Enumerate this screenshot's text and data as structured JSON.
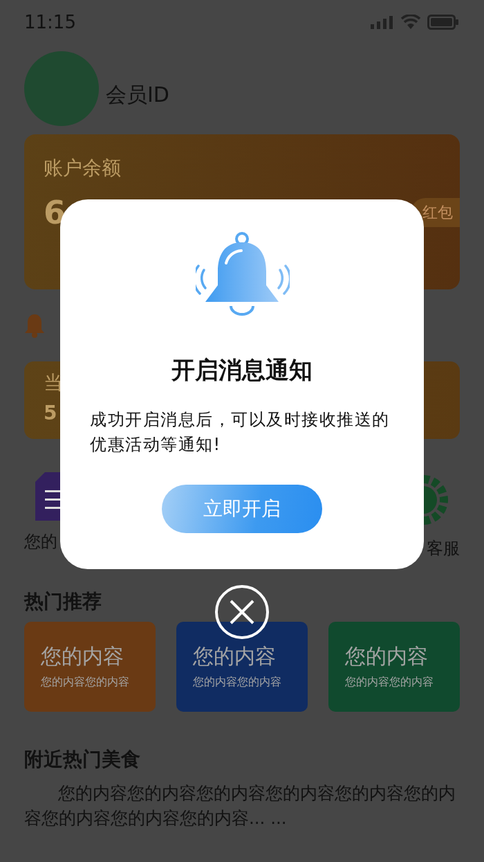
{
  "status_bar": {
    "time": "11:15"
  },
  "profile": {
    "name": "会员ID"
  },
  "balance_card": {
    "label": "账户余额",
    "amount": "6",
    "button": "红包"
  },
  "second_card": {
    "label": "当",
    "value": "5"
  },
  "shortcuts": [
    {
      "kind": "document",
      "label": "您的"
    },
    {
      "kind": "gear",
      "label": "客服"
    }
  ],
  "hot": {
    "title": "热门推荐",
    "cards": [
      {
        "title": "您的内容",
        "subtitle": "您的内容您的内容",
        "color": "#6a3a14"
      },
      {
        "title": "您的内容",
        "subtitle": "您的内容您的内容",
        "color": "#102c62"
      },
      {
        "title": "您的内容",
        "subtitle": "您的内容您的内容",
        "color": "#104a2e"
      }
    ]
  },
  "nearby": {
    "title": "附近热门美食",
    "text": "您的内容您的内容您的内容您的内容您的内容您的内容您的内容您的内容您的内容... ..."
  },
  "dialog": {
    "title": "开启消息通知",
    "message": "成功开启消息后，可以及时接收推送的优惠活动等通知!",
    "button": "立即开启"
  }
}
